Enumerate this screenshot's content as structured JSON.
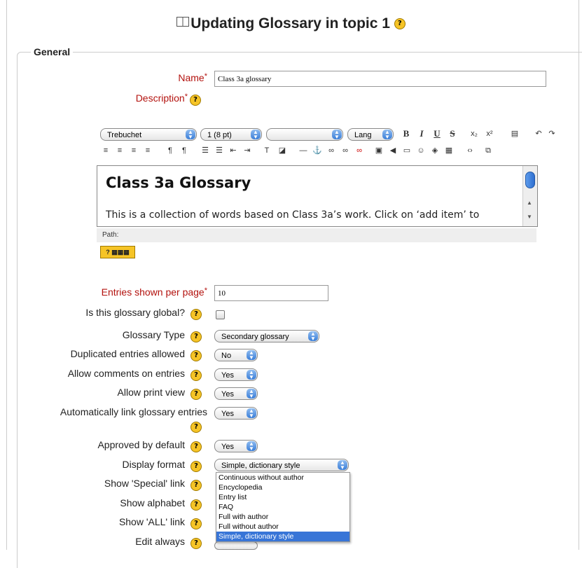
{
  "page": {
    "title": "Updating Glossary in topic 1"
  },
  "fieldset": {
    "legend": "General"
  },
  "help_glyph": "?",
  "required_star": "*",
  "fields": {
    "name": {
      "label": "Name",
      "value": "Class 3a glossary"
    },
    "description": {
      "label": "Description"
    },
    "entries_per_page": {
      "label": "Entries shown per page",
      "value": "10"
    },
    "global": {
      "label": "Is this glossary global?"
    },
    "type": {
      "label": "Glossary Type",
      "value": "Secondary glossary"
    },
    "duplicated": {
      "label": "Duplicated entries allowed",
      "value": "No"
    },
    "comments": {
      "label": "Allow comments on entries",
      "value": "Yes"
    },
    "print_view": {
      "label": "Allow print view",
      "value": "Yes"
    },
    "autolink": {
      "label": "Automatically link glossary entries",
      "value": "Yes"
    },
    "approved": {
      "label": "Approved by default",
      "value": "Yes"
    },
    "display_format": {
      "label": "Display format",
      "value": "Simple, dictionary style"
    },
    "special_link": {
      "label": "Show 'Special' link"
    },
    "alphabet": {
      "label": "Show alphabet"
    },
    "all_link": {
      "label": "Show 'ALL' link"
    },
    "edit_always": {
      "label": "Edit always"
    }
  },
  "editor": {
    "font": "Trebuchet",
    "size": "1 (8 pt)",
    "heading": "",
    "lang": "Lang",
    "bold": "B",
    "italic": "I",
    "underline": "U",
    "strike": "S",
    "heading_text": "Class 3a Glossary",
    "body_text": "This is a collection of words based on Class 3a’s work. Click on ‘add item’ to",
    "path_label": "Path:"
  },
  "display_format_options": [
    "Continuous without author",
    "Encyclopedia",
    "Entry list",
    "FAQ",
    "Full with author",
    "Full without author",
    "Simple, dictionary style"
  ]
}
